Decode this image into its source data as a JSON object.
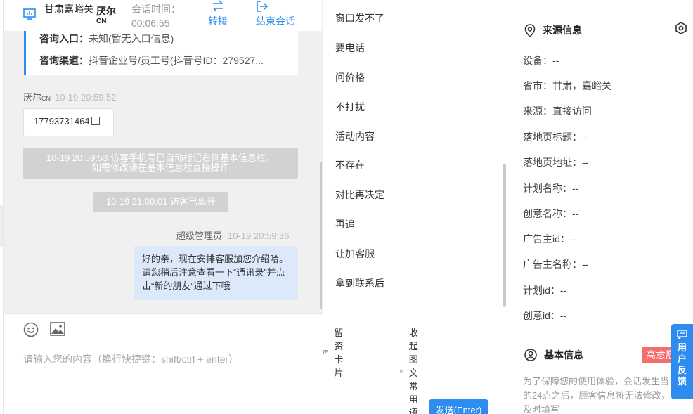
{
  "header": {
    "location": "甘肃嘉峪关",
    "user_name": "厌尔",
    "user_suffix": "CN",
    "time_label": "会话时间：",
    "time_value": "00:06:55",
    "transfer": "转接",
    "end_session": "结束会话"
  },
  "info_card": {
    "entry_label": "咨询入口：",
    "entry_value": "未知(暂无入口信息)",
    "channel_label": "咨询渠道：",
    "channel_value": "抖音企业号/员工号(抖音号ID：279527..."
  },
  "messages": {
    "sender1_name": "厌尔",
    "sender1_suffix": "CN",
    "sender1_time": "10-19 20:59:52",
    "phone": "17793731464",
    "sys1_line1": "10-19 20:59:53 访客手机号已自动标记右侧基本信息栏，",
    "sys1_line2": "如需修改请在基本信息栏直接操作",
    "sys2": "10-19 21:00:01 访客已离开",
    "sender2_name": "超级管理员",
    "sender2_time": "10-19 20:59:36",
    "bubble_text": "好的亲，现在安排客服加您介绍哈。请您稍后注意查看一下“通讯录”并点击“新的朋友”通过下哦"
  },
  "input": {
    "card_tool": "留资卡片",
    "collapse_tool": "收起图文常用语",
    "placeholder": "请输入您的内容（换行快捷键：shift/ctrl + enter）",
    "send": "发送(Enter)"
  },
  "quick_replies": [
    "窗口发不了",
    "要电话",
    "问价格",
    "不打扰",
    "活动内容",
    "不存在",
    "对比再决定",
    "再追",
    "让加客服",
    "拿到联系后"
  ],
  "source": {
    "title": "来源信息",
    "fields": [
      "设备：--",
      "省市：甘肃，嘉峪关",
      "来源：直接访问",
      "落地页标题：--",
      "落地页地址：--",
      "计划名称：--",
      "创意名称：--",
      "广告主id：--",
      "广告主名称：--",
      "计划id：--",
      "创意id：--"
    ]
  },
  "basic": {
    "title": "基本信息",
    "badge": "高意愿",
    "note": "为了保障您的使用体验，会话发生当日的24点之后，顾客信息将无法修改，请及时填写"
  },
  "feedback": [
    "用",
    "户",
    "反",
    "馈"
  ],
  "colors": {
    "accent": "#2d8cf0",
    "badge": "#f56c6c",
    "bubble": "#dbe9fb"
  }
}
